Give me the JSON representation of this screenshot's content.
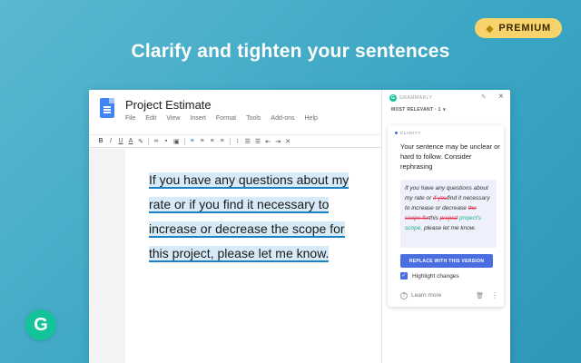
{
  "badge": {
    "icon": "gem-icon",
    "label": "PREMIUM"
  },
  "headline": "Clarify and tighten your sentences",
  "doc": {
    "title": "Project Estimate",
    "menu": [
      "File",
      "Edit",
      "View",
      "Insert",
      "Format",
      "Tools",
      "Add-ons",
      "Help"
    ],
    "lines": [
      "If you have any questions about my",
      "rate or if you find it necessary to",
      "increase or decrease the scope for",
      "this project, please let me know."
    ]
  },
  "panel": {
    "brand": "GRAMMARLY",
    "sort_label": "MOST RELEVANT · 1 ∨",
    "card": {
      "category": "CLARITY",
      "message": "Your sentence may be unclear or hard to follow. Consider rephrasing",
      "suggestion": {
        "part1": "If you have any questions about my rate or ",
        "del1": "if you",
        "part2": "find it necessary to increase or decrease ",
        "del2": "the scope for",
        "part3": "this ",
        "del3": "project",
        "ins": " project's scope,",
        "part4": " please let me know."
      },
      "replace_label": "REPLACE WITH THIS VERSION",
      "highlight_label": "Highlight changes",
      "learn_more": "Learn more"
    }
  },
  "colors": {
    "accent": "#4a6ee0",
    "grammarly_green": "#15c39a",
    "premium": "#f7d36b"
  }
}
